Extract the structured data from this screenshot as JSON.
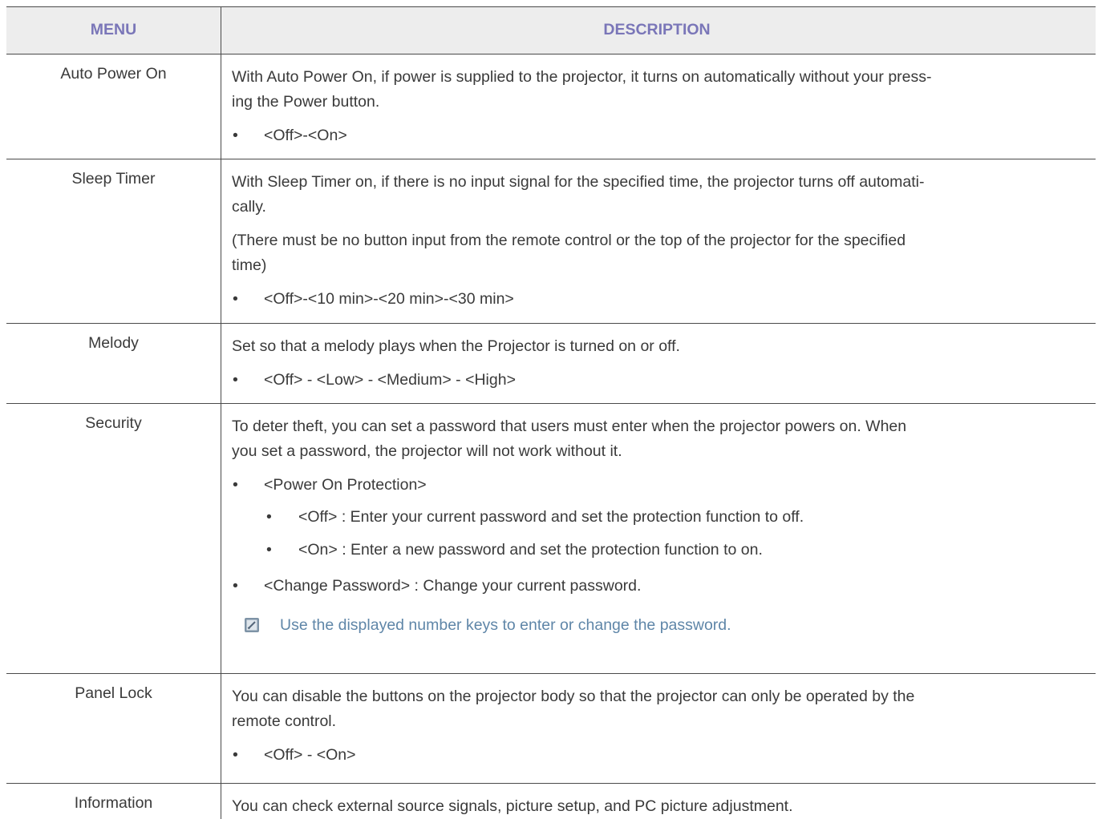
{
  "header": {
    "menu_label": "MENU",
    "description_label": "DESCRIPTION"
  },
  "rows": [
    {
      "menu": "Auto Power On",
      "paragraphs": [
        "With Auto Power On, if power is supplied to the projector, it turns on automatically without your press-",
        "ing the Power button."
      ],
      "bullets": [
        "<Off>-<On>"
      ]
    },
    {
      "menu": "Sleep Timer",
      "paragraphs": [
        "With Sleep Timer on, if there is no input signal for the specified time, the projector turns off automati-",
        "cally.",
        "(There must be no button input from the remote control or the top of the projector for the specified",
        "time)"
      ],
      "bullets": [
        "<Off>-<10 min>-<20 min>-<30 min>"
      ]
    },
    {
      "menu": "Melody",
      "paragraphs": [
        "Set so that a melody plays when the Projector is turned on or off."
      ],
      "bullets": [
        "<Off> - <Low> - <Medium> - <High>"
      ]
    },
    {
      "menu": "Security",
      "paragraphs": [
        "To deter theft, you can set a password that users must enter when the projector powers on. When",
        "you set a password, the projector will not work without it."
      ],
      "bullets": [
        "<Power On Protection>",
        "<Change Password> : Change your current password."
      ],
      "sub_bullets": [
        "<Off> : Enter your current password and set the protection function to off.",
        "<On> : Enter a new password and set the protection function to on."
      ],
      "note": "Use the displayed number keys to enter or change the password.",
      "note_icon": "pencil-note-icon"
    },
    {
      "menu": "Panel Lock",
      "paragraphs": [
        "You can disable the buttons on the projector body so that the projector can only be operated by the",
        "remote control."
      ],
      "bullets": [
        "<Off> - <On>"
      ]
    },
    {
      "menu": "Information",
      "paragraphs": [
        "You can check external source signals, picture setup, and PC picture adjustment."
      ]
    }
  ],
  "bullet_char": "•",
  "colors": {
    "header_text": "#7a76b8",
    "header_bg": "#ededed",
    "note_text": "#5f86a8",
    "body_text": "#3a3a3a"
  }
}
